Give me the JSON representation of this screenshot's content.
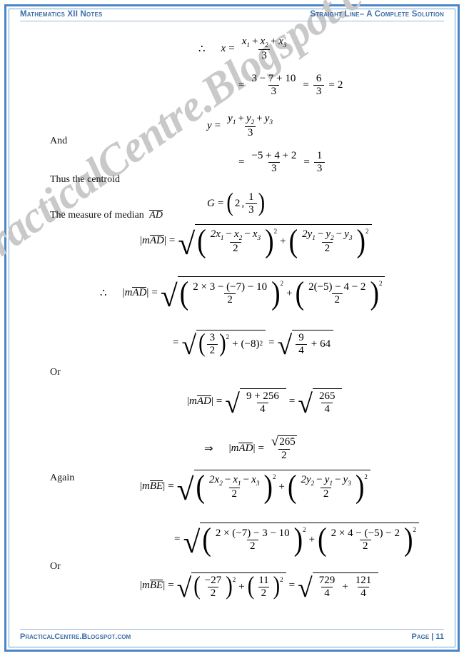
{
  "document": {
    "header": {
      "left": "Mathematics XII Notes",
      "right": "Straight Line– A Complete Solution"
    },
    "footer": {
      "left": "PracticalCentre.Blogspot.com",
      "right": "Page | 11"
    },
    "watermark": "PracticalCentre.Blogspot.com",
    "accent_color": "#3d6fa8",
    "border_color": "#4a86c8",
    "watermark_color": "#c9c9c9"
  },
  "labels": {
    "and": "And",
    "thus_centroid": "Thus the centroid",
    "measure_median_ad": "The measure of median",
    "or_1": "Or",
    "again": "Again",
    "or_2": "Or"
  },
  "symbols": {
    "therefore": "∴",
    "implies": "⇒",
    "equals": "=",
    "plus": "+",
    "minus": "−",
    "times": "×",
    "comma": ","
  },
  "math": {
    "x_formula": {
      "lhs": "x",
      "num": [
        "x",
        "1",
        "+",
        "x",
        "2",
        "+",
        "x",
        "3"
      ],
      "den": "3"
    },
    "x_value": {
      "num_terms": [
        "3",
        "−",
        "7",
        "+",
        "10"
      ],
      "den": "3",
      "simplified_num": "6",
      "simplified_den": "3",
      "result": "2"
    },
    "y_formula": {
      "lhs": "y",
      "num": [
        "y",
        "1",
        "+",
        "y",
        "2",
        "+",
        "y",
        "3"
      ],
      "den": "3"
    },
    "y_value": {
      "num_terms": [
        "−5",
        "+",
        "4",
        "+",
        "2"
      ],
      "den": "3",
      "result_num": "1",
      "result_den": "3"
    },
    "centroid": {
      "lhs": "G",
      "x": "2",
      "y_num": "1",
      "y_den": "3"
    },
    "segment_ad": "AD",
    "segment_be": "BE",
    "ad_general": {
      "lhs_prefix": "m",
      "term1_num": [
        "2x",
        "1",
        "−",
        "x",
        "2",
        "−",
        "x",
        "3"
      ],
      "term1_den": "2",
      "term2_num": [
        "2y",
        "1",
        "−",
        "y",
        "2",
        "−",
        "y",
        "3"
      ],
      "term2_den": "2",
      "power": "2"
    },
    "ad_substituted": {
      "term1_num": "2 × 3 − (−7) − 10",
      "term1_den": "2",
      "term2_num": "2(−5) − 4 − 2",
      "term2_den": "2",
      "power": "2"
    },
    "ad_simplified": {
      "frac_num": "3",
      "frac_den": "2",
      "power": "2",
      "second_term": "(−8)",
      "second_power": "2",
      "result_num": "9",
      "result_den": "4",
      "result_add": "64"
    },
    "ad_combined": {
      "num": "9 + 256",
      "den": "4",
      "result_num": "265",
      "result_den": "4"
    },
    "ad_final": {
      "radicand": "265",
      "den": "2"
    },
    "be_general": {
      "lhs_prefix": "m",
      "term1_num": [
        "2x",
        "2",
        "−",
        "x",
        "1",
        "−",
        "x",
        "3"
      ],
      "term1_den": "2",
      "term2_num": [
        "2y",
        "2",
        "−",
        "y",
        "1",
        "−",
        "y",
        "3"
      ],
      "term2_den": "2",
      "power": "2"
    },
    "be_substituted": {
      "term1_num": "2 × (−7) − 3 − 10",
      "term1_den": "2",
      "term2_num": "2 × 4 − (−5) − 2",
      "term2_den": "2",
      "power": "2"
    },
    "be_final": {
      "term1_num": "−27",
      "term1_den": "2",
      "term1_power": "2",
      "term2_num": "11",
      "term2_den": "2",
      "term2_power": "2",
      "result1_num": "729",
      "result1_den": "4",
      "result2_num": "121",
      "result2_den": "4"
    }
  }
}
